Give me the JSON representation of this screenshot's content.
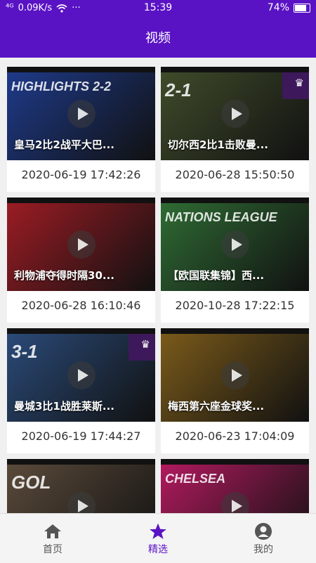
{
  "status_bar": {
    "signal": "⁴ᴳ",
    "speed": "0.09K/s",
    "wifi": "wifi-icon",
    "dots": "···",
    "time": "15:39",
    "battery": "74%",
    "battery_level": 0.74
  },
  "app_bar": {
    "title": "视频"
  },
  "videos": [
    {
      "title": "皇马2比2战平大巴...",
      "date": "2020-06-19 17:42:26",
      "bg": "#1e3a8a",
      "overlay": "HIGHLIGHTS 2-2"
    },
    {
      "title": "切尔西2比1击败曼...",
      "date": "2020-06-28 15:50:50",
      "bg": "#3f4b2a",
      "overlay": "2-1"
    },
    {
      "title": "利物浦夺得时隔30...",
      "date": "2020-06-28 16:10:46",
      "bg": "#9b1c24",
      "overlay": ""
    },
    {
      "title": "【欧国联集锦】西...",
      "date": "2020-10-28 17:22:15",
      "bg": "#2f6b34",
      "overlay": "NATIONS LEAGUE"
    },
    {
      "title": "曼城3比1战胜莱斯...",
      "date": "2020-06-19 17:44:27",
      "bg": "#2a4a78",
      "overlay": "3-1"
    },
    {
      "title": "梅西第六座金球奖...",
      "date": "2020-06-23 17:04:09",
      "bg": "#7a5a1a",
      "overlay": ""
    },
    {
      "title": "",
      "date": "",
      "bg": "#5a4a3a",
      "overlay": "GOL"
    },
    {
      "title": "",
      "date": "",
      "bg": "#b01a5e",
      "overlay": "CHELSEA"
    }
  ],
  "tabs": [
    {
      "label": "首页",
      "icon": "home-icon"
    },
    {
      "label": "精选",
      "icon": "star-icon"
    },
    {
      "label": "我的",
      "icon": "account-icon"
    }
  ]
}
